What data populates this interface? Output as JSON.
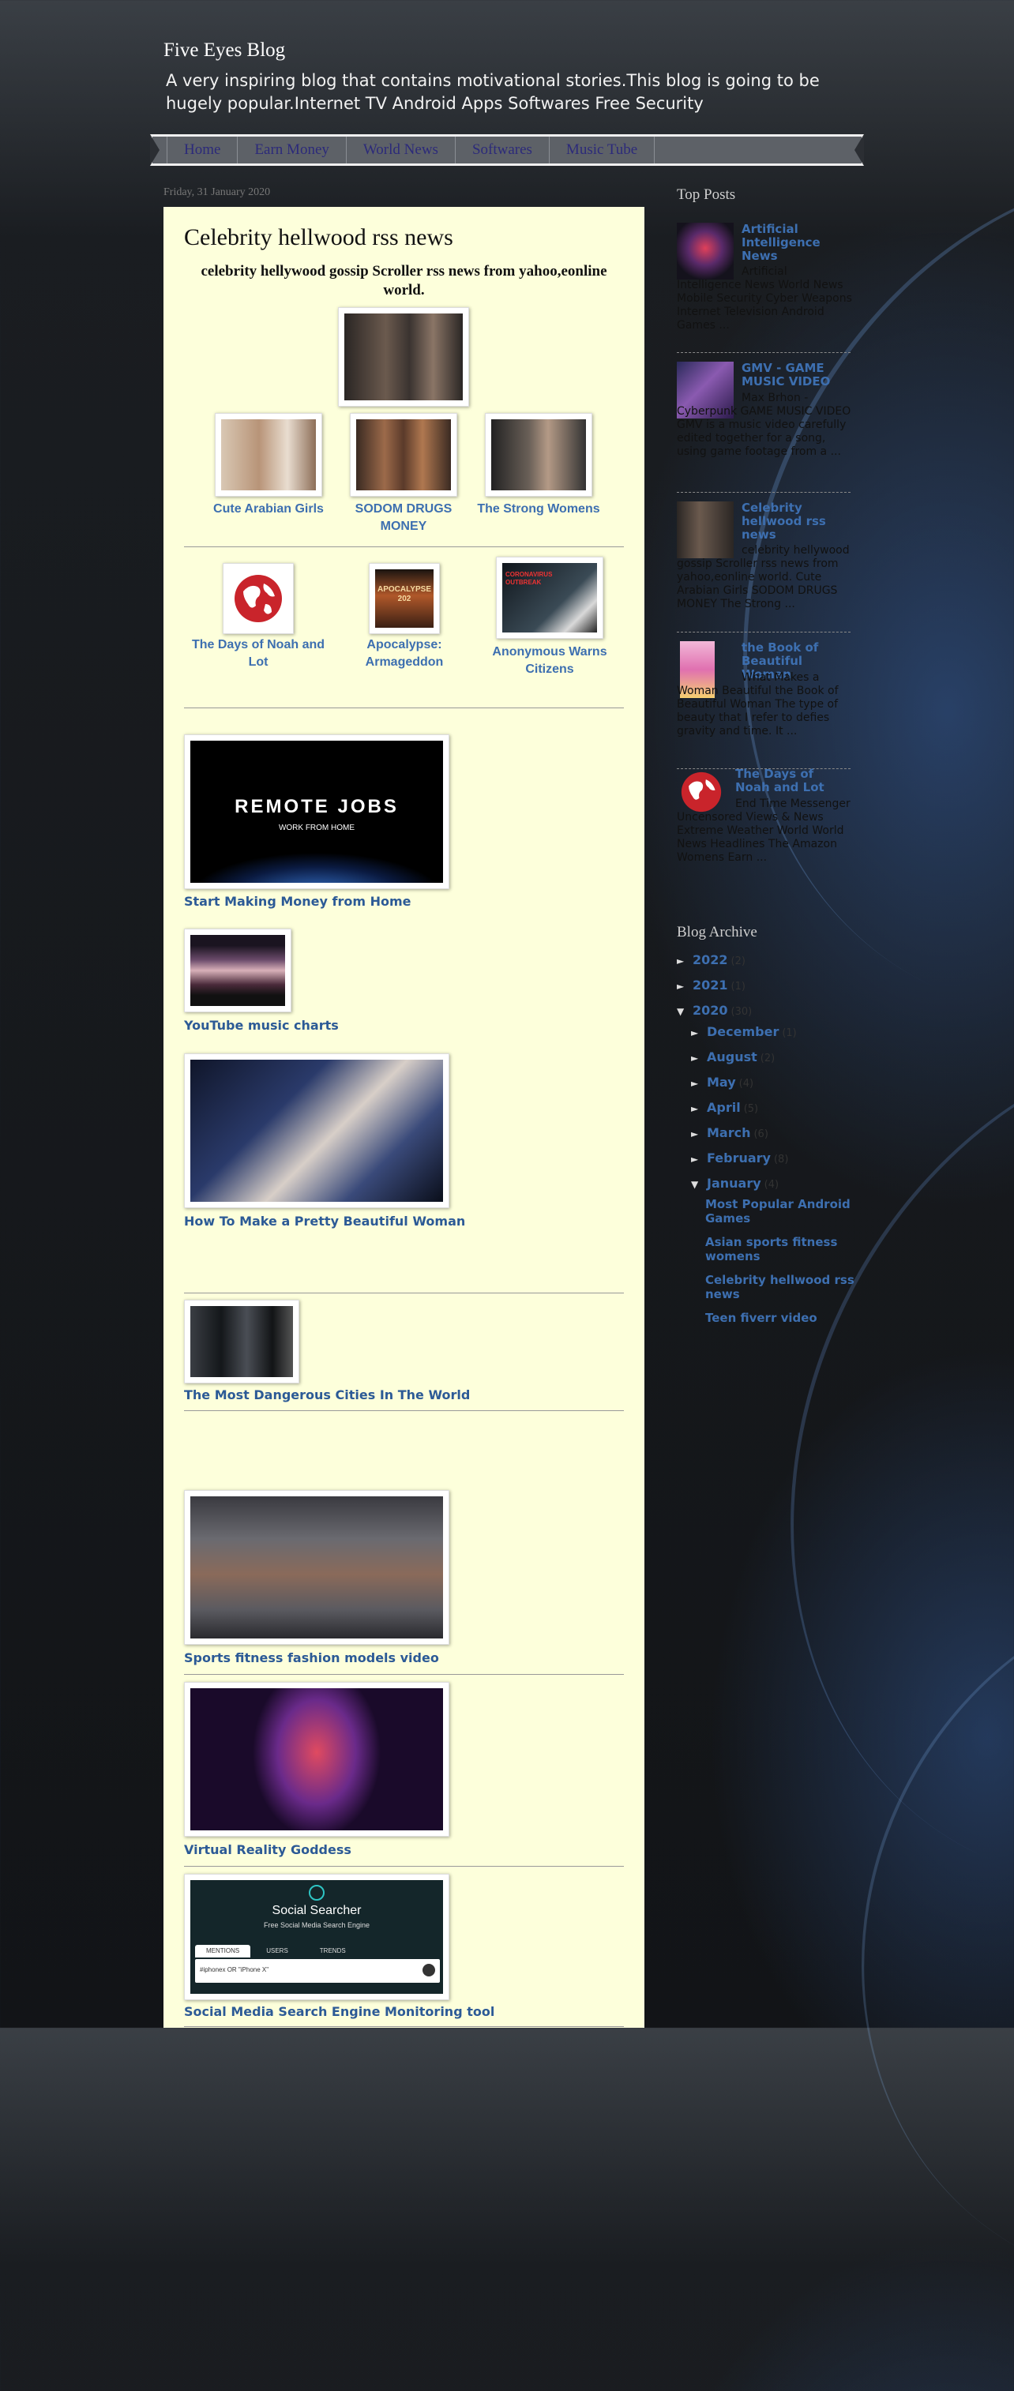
{
  "header": {
    "title": "Five Eyes Blog",
    "description": "A very inspiring blog that contains motivational stories.This blog is going to be hugely popular.Internet TV Android Apps Softwares Free Security"
  },
  "nav": {
    "items": [
      "Home",
      "Earn Money",
      "World News",
      "Softwares",
      "Music Tube"
    ]
  },
  "post": {
    "date": "Friday, 31 January 2020",
    "title": "Celebrity hellwood rss news",
    "subtitle": "celebrity hellywood gossip Scroller rss news from yahoo,eonline world.",
    "row1": [
      "Cute Arabian Girls",
      "SODOM DRUGS MONEY",
      "The Strong Womens"
    ],
    "row2": [
      "The Days of Noah and Lot",
      "Apocalypse: Armageddon",
      "Anonymous Warns Citizens"
    ],
    "apocalypse_thumb_text": "APOCALYPSE 202",
    "coronavirus_thumb_text": "CORONAVIRUS OUTBREAK",
    "remote_jobs_title": "REMOTE JOBS",
    "remote_jobs_sub": "WORK FROM HOME",
    "links": [
      "Start Making Money from Home",
      "YouTube music charts",
      "How To Make a Pretty Beautiful Woman",
      "The Most Dangerous Cities In The World",
      "Sports fitness fashion models video",
      "Virtual Reality Goddess",
      "Social Media Search Engine Monitoring tool"
    ],
    "social_searcher": {
      "title": "Social Searcher",
      "sub": "Free Social Media Search Engine",
      "tabs": [
        "MENTIONS",
        "USERS",
        "TRENDS"
      ],
      "query": "#iphonex OR \"iPhone X\""
    }
  },
  "sidebar": {
    "top_posts_heading": "Top Posts",
    "top_posts": [
      {
        "title": "Artificial Intelligence News",
        "snippet": "Artificial Intelligence News   World News Mobile Security Cyber Weapons Internet Television Android Games ..."
      },
      {
        "title": "GMV - GAME MUSIC VIDEO",
        "snippet": "Max Brhon - Cyberpunk GAME MUSIC VIDEO GMV is a music video carefully edited together for a song, using game footage from a ..."
      },
      {
        "title": "Celebrity hellwood rss news",
        "snippet": "celebrity hellywood gossip Scroller rss news from yahoo,eonline world. Cute Arabian Girls SODOM DRUGS MONEY The Strong ..."
      },
      {
        "title": "the Book of Beautiful Woman",
        "snippet": "What Makes a Woman Beautiful the Book of Beautiful Woman The type of beauty that I refer to defies gravity and time. It ..."
      },
      {
        "title": "The Days of Noah and Lot",
        "snippet": "End Time Messenger Uncensored Views & News Extreme Weather World World News Headlines The Amazon Womens Earn ..."
      }
    ],
    "archive_heading": "Blog Archive",
    "archive": [
      {
        "label": "2022",
        "count": "(2)",
        "arrow": "►"
      },
      {
        "label": "2021",
        "count": "(1)",
        "arrow": "►"
      },
      {
        "label": "2020",
        "count": "(30)",
        "arrow": "▼"
      }
    ],
    "months": [
      {
        "label": "December",
        "count": "(1)",
        "arrow": "►"
      },
      {
        "label": "August",
        "count": "(2)",
        "arrow": "►"
      },
      {
        "label": "May",
        "count": "(4)",
        "arrow": "►"
      },
      {
        "label": "April",
        "count": "(5)",
        "arrow": "►"
      },
      {
        "label": "March",
        "count": "(6)",
        "arrow": "►"
      },
      {
        "label": "February",
        "count": "(8)",
        "arrow": "►"
      },
      {
        "label": "January",
        "count": "(4)",
        "arrow": "▼"
      }
    ],
    "january_posts": [
      "Most Popular Android Games",
      "Asian sports fitness womens",
      "Celebrity hellwood rss news",
      "Teen fiverr video"
    ]
  }
}
